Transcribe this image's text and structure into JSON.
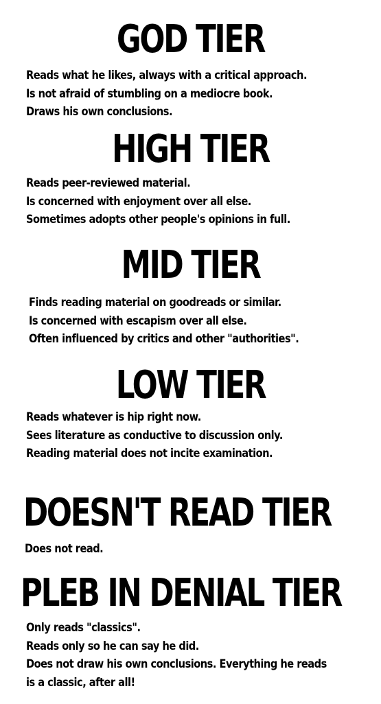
{
  "tiers": [
    {
      "title": "GOD TIER",
      "lines": [
        "Reads what he likes, always with a critical approach.",
        "Is not afraid of stumbling on a mediocre book.",
        "Draws his own conclusions."
      ]
    },
    {
      "title": "HIGH TIER",
      "lines": [
        "Reads peer-reviewed material.",
        "Is concerned with enjoyment over all else.",
        "Sometimes adopts other people's opinions in full."
      ]
    },
    {
      "title": "MID TIER",
      "lines": [
        "Finds reading material on goodreads or similar.",
        "Is concerned with escapism over all else.",
        "Often influenced by critics and other \"authorities\"."
      ]
    },
    {
      "title": "LOW TIER",
      "lines": [
        "Reads whatever is hip right now.",
        "Sees literature as conductive to discussion only.",
        "Reading material does not incite examination."
      ]
    },
    {
      "title": "DOESN'T READ TIER",
      "lines": [
        "Does not read."
      ]
    },
    {
      "title": "PLEB IN DENIAL TIER",
      "lines": [
        "Only reads \"classics\".",
        "Reads only so he can say he did.",
        "Does not draw his own conclusions. Everything he reads",
        "is a classic, after all!"
      ]
    }
  ]
}
